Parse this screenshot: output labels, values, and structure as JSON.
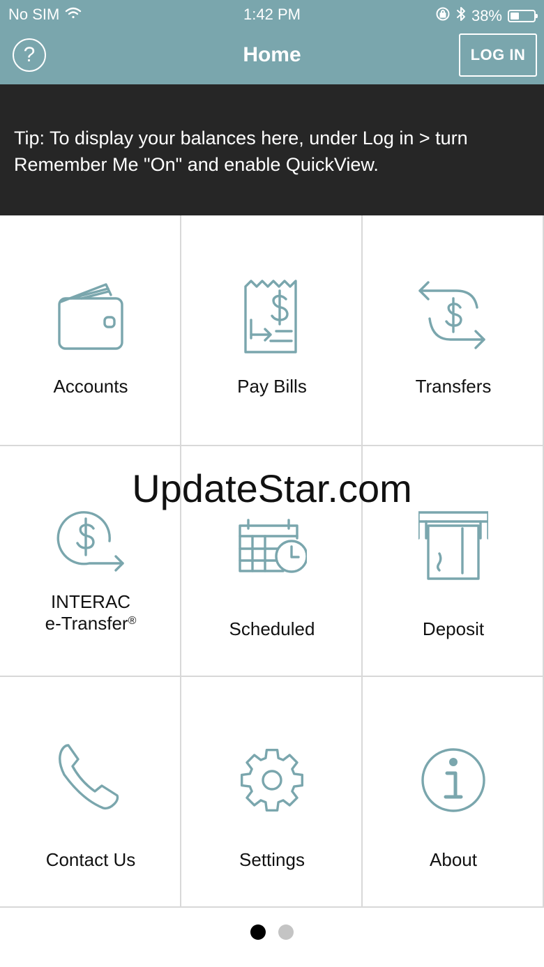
{
  "status_bar": {
    "carrier": "No SIM",
    "time": "1:42 PM",
    "battery_percent": "38%",
    "battery_level": 0.38
  },
  "nav": {
    "title": "Home",
    "help_symbol": "?",
    "login_label": "LOG IN"
  },
  "tip": {
    "text": "Tip: To display your balances here, under Log in > turn Remember Me \"On\" and enable QuickView."
  },
  "tiles": [
    {
      "label": "Accounts",
      "icon": "wallet-icon"
    },
    {
      "label": "Pay Bills",
      "icon": "bill-icon"
    },
    {
      "label": "Transfers",
      "icon": "transfer-icon"
    },
    {
      "label_line1": "INTERAC",
      "label_line2": "e-Transfer",
      "label_sup": "®",
      "icon": "e-transfer-icon"
    },
    {
      "label": "Scheduled",
      "icon": "calendar-clock-icon"
    },
    {
      "label": "Deposit",
      "icon": "cheque-deposit-icon"
    },
    {
      "label": "Contact Us",
      "icon": "phone-icon"
    },
    {
      "label": "Settings",
      "icon": "gear-icon"
    },
    {
      "label": "About",
      "icon": "info-icon"
    }
  ],
  "watermark": "UpdateStar.com",
  "pager": {
    "pages": 2,
    "current": 1
  },
  "colors": {
    "accent": "#7aa6ad",
    "banner": "#262626"
  }
}
